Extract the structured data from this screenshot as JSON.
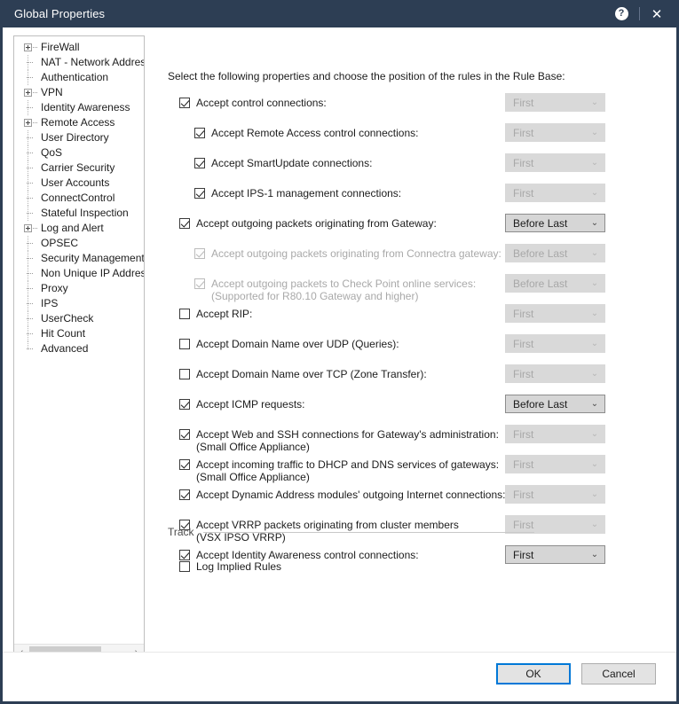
{
  "window": {
    "title": "Global Properties",
    "help_icon": "help-icon",
    "close_icon": "close-icon"
  },
  "tree": {
    "items": [
      {
        "label": "FireWall",
        "expandable": true
      },
      {
        "label": "NAT - Network Addres",
        "expandable": false
      },
      {
        "label": "Authentication",
        "expandable": false
      },
      {
        "label": "VPN",
        "expandable": true
      },
      {
        "label": "Identity Awareness",
        "expandable": false
      },
      {
        "label": "Remote Access",
        "expandable": true
      },
      {
        "label": "User Directory",
        "expandable": false
      },
      {
        "label": "QoS",
        "expandable": false
      },
      {
        "label": "Carrier Security",
        "expandable": false
      },
      {
        "label": "User Accounts",
        "expandable": false
      },
      {
        "label": "ConnectControl",
        "expandable": false
      },
      {
        "label": "Stateful Inspection",
        "expandable": false
      },
      {
        "label": "Log and Alert",
        "expandable": true
      },
      {
        "label": "OPSEC",
        "expandable": false
      },
      {
        "label": "Security Management .",
        "expandable": false
      },
      {
        "label": "Non Unique IP Address",
        "expandable": false
      },
      {
        "label": "Proxy",
        "expandable": false
      },
      {
        "label": "IPS",
        "expandable": false
      },
      {
        "label": "UserCheck",
        "expandable": false
      },
      {
        "label": "Hit Count",
        "expandable": false
      },
      {
        "label": "Advanced",
        "expandable": false
      }
    ],
    "scrollbar": {
      "left_arrow": "chevron-left-icon",
      "right_arrow": "chevron-right-icon"
    }
  },
  "main": {
    "intro": "Select the following properties and choose the position of the rules in the Rule Base:",
    "rows": [
      {
        "label": "Accept control connections:",
        "sub": "",
        "checked": true,
        "disabled": false,
        "indent": false,
        "dropdown": "First",
        "dropdown_disabled": true
      },
      {
        "label": "Accept Remote Access control connections:",
        "sub": "",
        "checked": true,
        "disabled": false,
        "indent": true,
        "dropdown": "First",
        "dropdown_disabled": true
      },
      {
        "label": "Accept SmartUpdate connections:",
        "sub": "",
        "checked": true,
        "disabled": false,
        "indent": true,
        "dropdown": "First",
        "dropdown_disabled": true
      },
      {
        "label": "Accept IPS-1 management connections:",
        "sub": "",
        "checked": true,
        "disabled": false,
        "indent": true,
        "dropdown": "First",
        "dropdown_disabled": true
      },
      {
        "label": "Accept outgoing packets originating from Gateway:",
        "sub": "",
        "checked": true,
        "disabled": false,
        "indent": false,
        "dropdown": "Before Last",
        "dropdown_disabled": false
      },
      {
        "label": "Accept outgoing packets originating from Connectra gateway:",
        "sub": "",
        "checked": true,
        "disabled": true,
        "indent": true,
        "dropdown": "Before Last",
        "dropdown_disabled": true
      },
      {
        "label": "Accept outgoing packets to Check Point online services:",
        "sub": "(Supported for R80.10 Gateway and higher)",
        "checked": true,
        "disabled": true,
        "indent": true,
        "dropdown": "Before Last",
        "dropdown_disabled": true
      },
      {
        "label": "Accept RIP:",
        "sub": "",
        "checked": false,
        "disabled": false,
        "indent": false,
        "dropdown": "First",
        "dropdown_disabled": true
      },
      {
        "label": "Accept Domain Name over UDP (Queries):",
        "sub": "",
        "checked": false,
        "disabled": false,
        "indent": false,
        "dropdown": "First",
        "dropdown_disabled": true
      },
      {
        "label": "Accept Domain Name over TCP (Zone Transfer):",
        "sub": "",
        "checked": false,
        "disabled": false,
        "indent": false,
        "dropdown": "First",
        "dropdown_disabled": true
      },
      {
        "label": "Accept ICMP requests:",
        "sub": "",
        "checked": true,
        "disabled": false,
        "indent": false,
        "dropdown": "Before Last",
        "dropdown_disabled": false
      },
      {
        "label": "Accept Web and SSH connections for Gateway's administration:",
        "sub": "(Small Office Appliance)",
        "checked": true,
        "disabled": false,
        "indent": false,
        "dropdown": "First",
        "dropdown_disabled": true
      },
      {
        "label": "Accept incoming traffic to DHCP and DNS services of gateways:",
        "sub": "(Small Office Appliance)",
        "checked": true,
        "disabled": false,
        "indent": false,
        "dropdown": "First",
        "dropdown_disabled": true
      },
      {
        "label": "Accept Dynamic Address modules' outgoing Internet connections:",
        "sub": "",
        "checked": true,
        "disabled": false,
        "indent": false,
        "dropdown": "First",
        "dropdown_disabled": true
      },
      {
        "label": "Accept VRRP packets originating from cluster members",
        "sub": "(VSX IPSO VRRP)",
        "checked": true,
        "disabled": false,
        "indent": false,
        "dropdown": "First",
        "dropdown_disabled": true
      },
      {
        "label": "Accept Identity Awareness control connections:",
        "sub": "",
        "checked": true,
        "disabled": false,
        "indent": false,
        "dropdown": "First",
        "dropdown_disabled": false
      }
    ],
    "track": {
      "title": "Track",
      "log_implied_rules": {
        "label": "Log Implied Rules",
        "checked": false
      }
    }
  },
  "footer": {
    "ok_label": "OK",
    "cancel_label": "Cancel"
  },
  "colors": {
    "titlebar": "#2d3e54",
    "focus_border": "#0078d7",
    "dropdown_bg": "#d6d6d6",
    "disabled_text": "#a9a9a9"
  }
}
